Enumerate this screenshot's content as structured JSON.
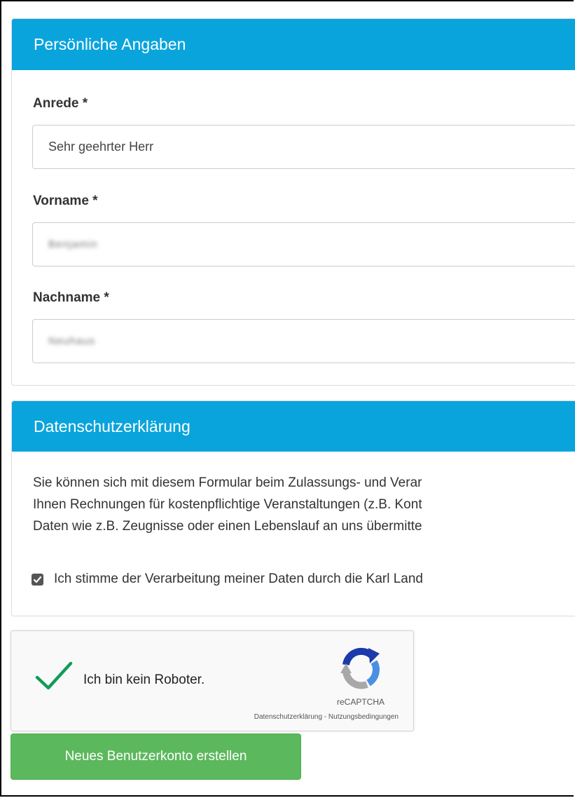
{
  "personal": {
    "heading": "Persönliche Angaben",
    "anrede_label": "Anrede *",
    "anrede_value": "Sehr geehrter Herr",
    "vorname_label": "Vorname *",
    "vorname_value": "Benjamin",
    "nachname_label": "Nachname *",
    "nachname_value": "Neuhaus"
  },
  "privacy": {
    "heading": "Datenschutzerklärung",
    "lines": [
      "Sie können sich mit diesem Formular beim Zulassungs- und Verar",
      "Ihnen Rechnungen für kostenpflichtige Veranstaltungen (z.B. Kont",
      "Daten wie z.B. Zeugnisse oder einen Lebenslauf an uns übermitte"
    ],
    "consent_label": "Ich stimme der Verarbeitung meiner Daten durch die Karl Land",
    "consent_checked": true
  },
  "recaptcha": {
    "label": "Ich bin kein Roboter.",
    "brand": "reCAPTCHA",
    "links": "Datenschutzerklärung - Nutzungsbedingungen",
    "checked": true,
    "check_color": "#0f9d58"
  },
  "submit": {
    "label": "Neues Benutzerkonto erstellen",
    "color": "#5cb85c"
  },
  "colors": {
    "panel_heading": "#0aa4dc"
  }
}
